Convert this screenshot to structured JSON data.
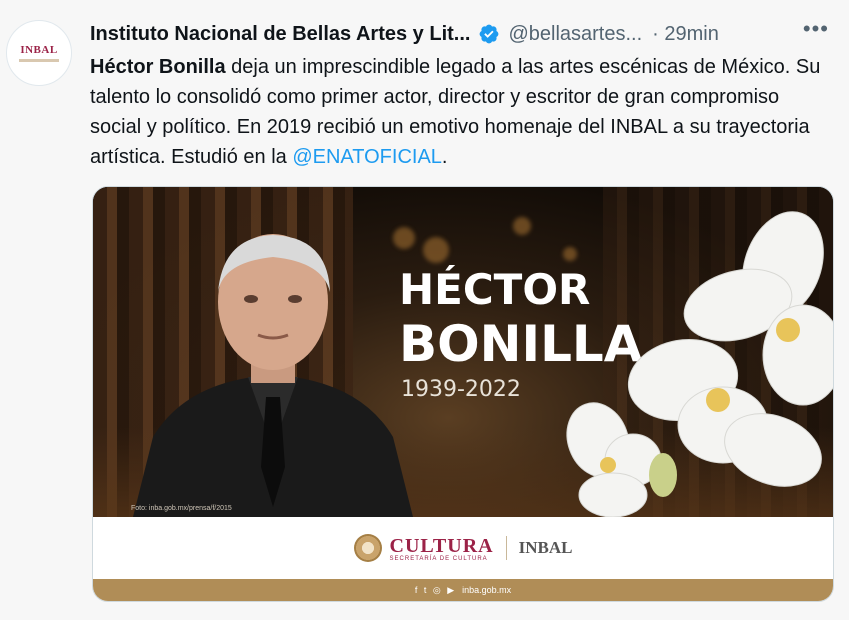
{
  "tweet": {
    "avatar_text": "INBAL",
    "author_name": "Instituto Nacional de Bellas Artes y Lit...",
    "handle": "@bellasartes...",
    "separator": "·",
    "time": "29min",
    "more": "•••",
    "text": {
      "bold": "Héctor Bonilla",
      "body": " deja un imprescindible legado a las artes escénicas de México. Su talento lo consolidó como primer actor, director y escritor de gran compromiso social y político. En 2019 recibió un emotivo homenaje del INBAL a su trayectoria artística. Estudió en la ",
      "mention": "@ENATOFICIAL",
      "tail": "."
    }
  },
  "media": {
    "name_line1": "HÉCTOR",
    "name_line2": "BONILLA",
    "years": "1939-2022",
    "photo_credit": "Foto: inba.gob.mx/prensa/f/2015",
    "footer_cultura": "CULTURA",
    "footer_cultura_sub": "SECRETARÍA DE CULTURA",
    "footer_inbal": "INBAL",
    "social_icons": "f t ◎ ▶",
    "website": "inba.gob.mx"
  },
  "colors": {
    "mention": "#1d9bf0",
    "verified": "#1d9bf0",
    "brand": "#9b2247"
  }
}
